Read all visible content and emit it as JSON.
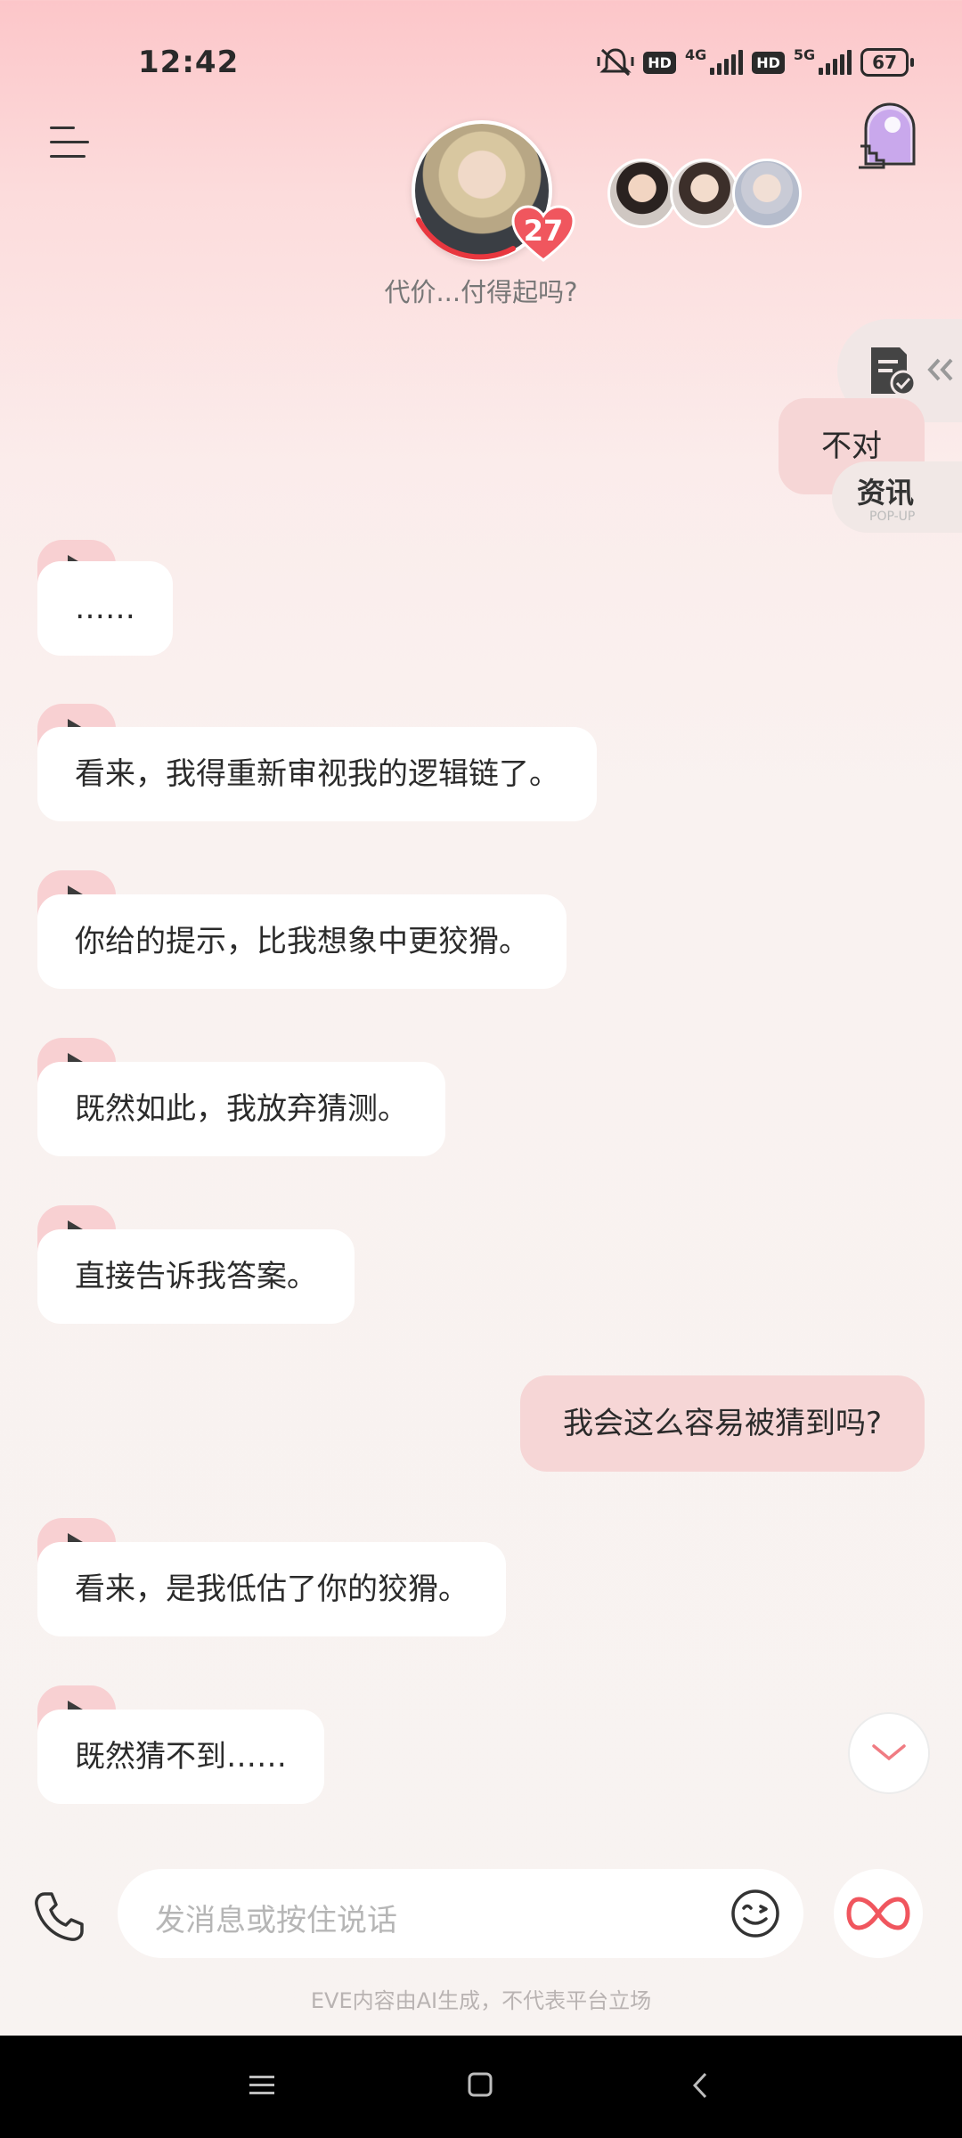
{
  "status_bar": {
    "time": "12:42",
    "hd1": "HD",
    "net1": "4G",
    "hd2": "HD",
    "net2": "5G",
    "battery": "67"
  },
  "header": {
    "affection_level": "27",
    "subtitle": "代价...付得起吗?"
  },
  "side_tabs": {
    "news_label": "资讯",
    "news_sub": "POP-UP"
  },
  "messages": [
    {
      "role": "me",
      "text": "不对"
    },
    {
      "role": "ai",
      "text": "……"
    },
    {
      "role": "ai",
      "text": "看来，我得重新审视我的逻辑链了。"
    },
    {
      "role": "ai",
      "text": "你给的提示，比我想象中更狡猾。"
    },
    {
      "role": "ai",
      "text": "既然如此，我放弃猜测。"
    },
    {
      "role": "ai",
      "text": "直接告诉我答案。"
    },
    {
      "role": "me",
      "text": "我会这么容易被猜到吗?"
    },
    {
      "role": "ai",
      "text": "看来，是我低估了你的狡猾。"
    },
    {
      "role": "ai",
      "text": "既然猜不到……"
    }
  ],
  "input": {
    "placeholder": "发消息或按住说话"
  },
  "footer": {
    "disclaimer": "EVE内容由AI生成，不代表平台立场"
  },
  "colors": {
    "accent": "#f0565e",
    "user_bubble": "#f6d6d6",
    "ai_bubble": "#ffffff",
    "play_tab": "#f8d0d2"
  }
}
